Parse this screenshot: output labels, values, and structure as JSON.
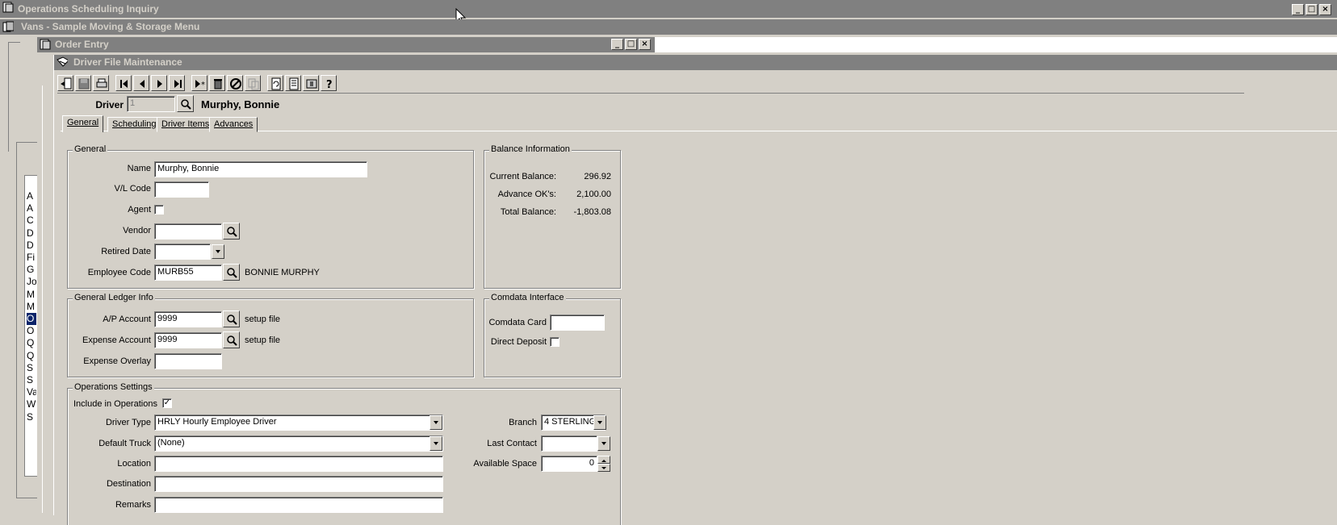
{
  "windows": {
    "ops_title": "Operations Scheduling Inquiry",
    "menu_title": "Vans - Sample Moving & Storage Menu",
    "order_title": "Order Entry",
    "driver_title": "Driver File Maintenance"
  },
  "left_list": [
    "A",
    "A",
    "C",
    "D",
    "D",
    "Fi",
    "G",
    "Jo",
    "M",
    "M",
    "O",
    "O",
    "Q",
    "Q",
    "S",
    "S",
    "Va",
    "W",
    "S"
  ],
  "header": {
    "driver_label": "Driver",
    "driver_id": "1",
    "driver_name": "Murphy, Bonnie"
  },
  "tabs": [
    "General",
    "Scheduling",
    "Driver Items",
    "Advances"
  ],
  "general": {
    "title": "General",
    "name_label": "Name",
    "name_value": "Murphy, Bonnie",
    "vl_label": "V/L Code",
    "agent_label": "Agent",
    "vendor_label": "Vendor",
    "retired_label": "Retired Date",
    "employee_label": "Employee Code",
    "employee_value": "MURB55",
    "employee_name": "BONNIE MURPHY"
  },
  "balance": {
    "title": "Balance Information",
    "current_label": "Current Balance:",
    "current_value": "296.92",
    "advance_label": "Advance OK's:",
    "advance_value": "2,100.00",
    "total_label": "Total Balance:",
    "total_value": "-1,803.08"
  },
  "gl": {
    "title": "General Ledger Info",
    "ap_label": "A/P Account",
    "ap_value": "9999",
    "ap_note": "setup file",
    "expense_label": "Expense Account",
    "expense_value": "9999",
    "expense_note": "setup file",
    "overlay_label": "Expense Overlay"
  },
  "comdata": {
    "title": "Comdata Interface",
    "card_label": "Comdata Card",
    "deposit_label": "Direct Deposit"
  },
  "ops": {
    "title": "Operations Settings",
    "include_label": "Include in Operations",
    "include_checked": "✓",
    "driver_type_label": "Driver Type",
    "driver_type_value": "HRLY   Hourly  Employee Driver",
    "default_truck_label": "Default Truck",
    "default_truck_value": "(None)",
    "location_label": "Location",
    "destination_label": "Destination",
    "remarks_label": "Remarks",
    "branch_label": "Branch",
    "branch_value": "4   STERLING",
    "last_contact_label": "Last Contact",
    "available_label": "Available Space",
    "available_value": "0"
  },
  "colors": {
    "face": "#d4d0c8",
    "inactive_title": "#808080",
    "shadow": "#404040"
  }
}
